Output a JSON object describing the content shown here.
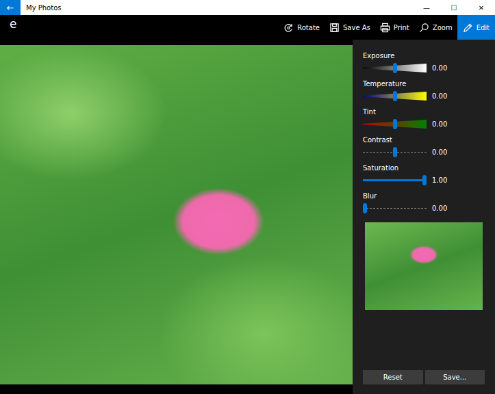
{
  "window": {
    "title": "My Photos",
    "back": "←",
    "controls": [
      "—",
      "☐",
      "✕"
    ]
  },
  "app_logo": "e",
  "toolbar": [
    {
      "label": "Rotate",
      "selected": false
    },
    {
      "label": "Save As",
      "selected": false
    },
    {
      "label": "Print",
      "selected": false
    },
    {
      "label": "Zoom",
      "selected": false
    },
    {
      "label": "Edit",
      "selected": true
    }
  ],
  "adjustments": [
    {
      "name": "Exposure",
      "kind": "gradient",
      "level": 0.5,
      "reading": "0.00"
    },
    {
      "name": "Temperature",
      "kind": "gradient",
      "level": 0.5,
      "reading": "0.00"
    },
    {
      "name": "Tint",
      "kind": "gradient",
      "level": 0.5,
      "reading": "0.00"
    },
    {
      "name": "Contrast",
      "kind": "centered",
      "level": 0.5,
      "reading": "0.00"
    },
    {
      "name": "Saturation",
      "kind": "line",
      "level": 1.0,
      "reading": "1.00"
    },
    {
      "name": "Blur",
      "kind": "line",
      "level": 0.0,
      "reading": "0.00"
    }
  ],
  "buttons": [
    "Reset",
    "Save..."
  ]
}
